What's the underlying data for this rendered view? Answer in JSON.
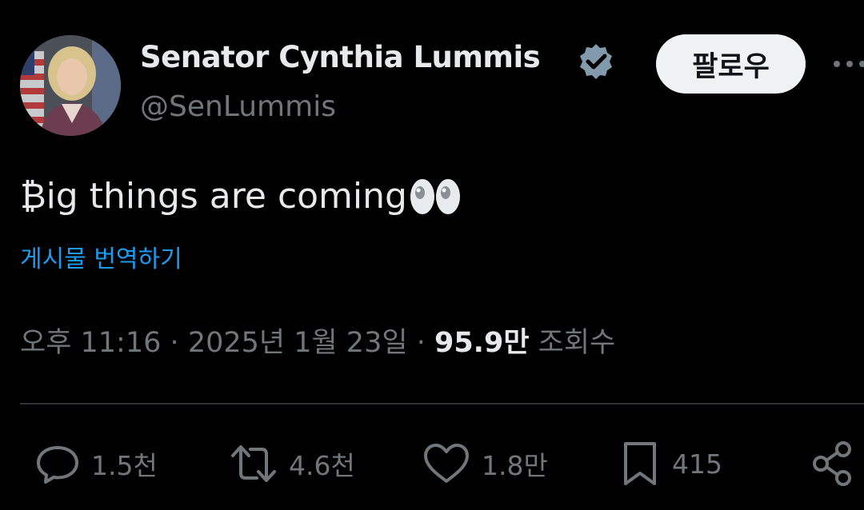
{
  "author": {
    "display_name": "Senator Cynthia Lummis",
    "handle": "@SenLummis",
    "verified_icon": "verified-badge-icon",
    "avatar_icon": "avatar-photo"
  },
  "header": {
    "follow_label": "팔로우",
    "more_icon": "more-horizontal-icon"
  },
  "tweet": {
    "text": "₿ig things are coming",
    "emoji": "eyes-emoji",
    "translate_label": "게시물 번역하기"
  },
  "meta": {
    "time": "오후 11:16",
    "separator": "·",
    "date": "2025년 1월 23일",
    "views_count": "95.9만",
    "views_label": "조회수"
  },
  "actions": {
    "reply": {
      "icon": "reply-icon",
      "count": "1.5천"
    },
    "retweet": {
      "icon": "retweet-icon",
      "count": "4.6천"
    },
    "like": {
      "icon": "heart-icon",
      "count": "1.8만"
    },
    "bookmark": {
      "icon": "bookmark-icon",
      "count": "415"
    },
    "share": {
      "icon": "share-icon"
    }
  },
  "colors": {
    "background": "#000000",
    "primary_text": "#e7e9ea",
    "secondary_text": "#71767b",
    "link": "#1d9bf0",
    "verified": "#829aab",
    "divider": "#2f3336",
    "follow_bg": "#eff3f4"
  }
}
